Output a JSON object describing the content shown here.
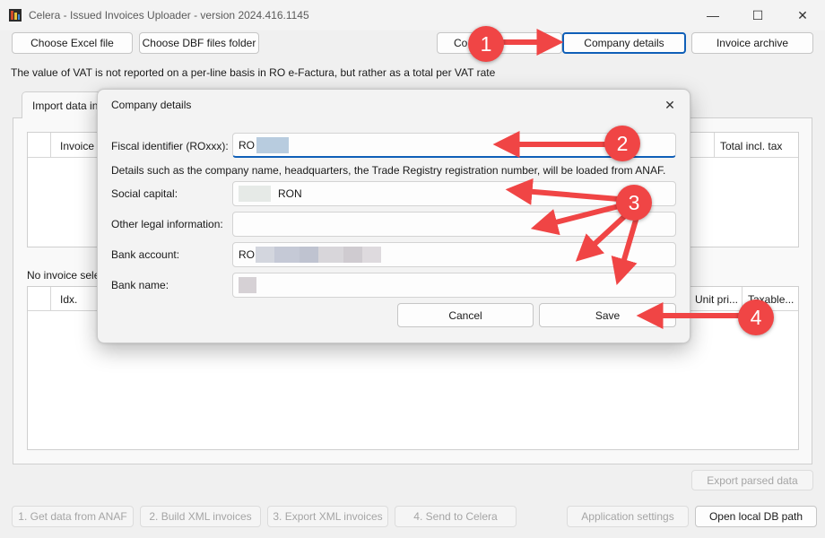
{
  "window": {
    "title": "Celera - Issued Invoices Uploader - version 2024.416.1145",
    "minimize_glyph": "—",
    "maximize_glyph": "☐",
    "close_glyph": "✕"
  },
  "toolbar": {
    "choose_excel": "Choose Excel file",
    "choose_dbf": "Choose DBF files folder",
    "company_settings_partial": "Co",
    "company_settings_end": "g",
    "company_details": "Company details",
    "invoice_archive": "Invoice archive"
  },
  "vat_info": "The value of VAT is not reported on a per-line basis in RO e-Factura, but rather as a total per VAT rate",
  "tab": {
    "label": "Import data invoices"
  },
  "invoices_table": {
    "col_invoice": "Invoice no.",
    "col_total": "Total incl. tax"
  },
  "selection_status": "No invoice selected",
  "lines_table": {
    "col_idx": "Idx.",
    "col_unit_price": "Unit pri...",
    "col_taxable": "Taxable..."
  },
  "bottom": {
    "export_parsed": "Export parsed data",
    "get_data": "1. Get data from ANAF",
    "build_xml": "2. Build XML invoices",
    "export_xml": "3. Export XML invoices",
    "send_celera": "4. Send to Celera",
    "app_settings": "Application settings",
    "open_db": "Open local DB path"
  },
  "dialog": {
    "title": "Company details",
    "close_glyph": "✕",
    "fiscal_label": "Fiscal identifier (ROxxx):",
    "fiscal_value": "RO",
    "anaf_note": "Details such as the company name, headquarters, the Trade Registry registration number, will be loaded from ANAF.",
    "capital_label": "Social capital:",
    "capital_value": "RON",
    "legal_label": "Other legal information:",
    "legal_value": "",
    "bank_account_label": "Bank account:",
    "bank_account_value": "RO",
    "bank_name_label": "Bank name:",
    "bank_name_value": "",
    "cancel": "Cancel",
    "save": "Save"
  },
  "annotations": {
    "step1": "1",
    "step2": "2",
    "step3": "3",
    "step4": "4",
    "color": "#f04545"
  },
  "colors": {
    "accent": "#0f5fb8",
    "annotation_red": "#f04545"
  }
}
